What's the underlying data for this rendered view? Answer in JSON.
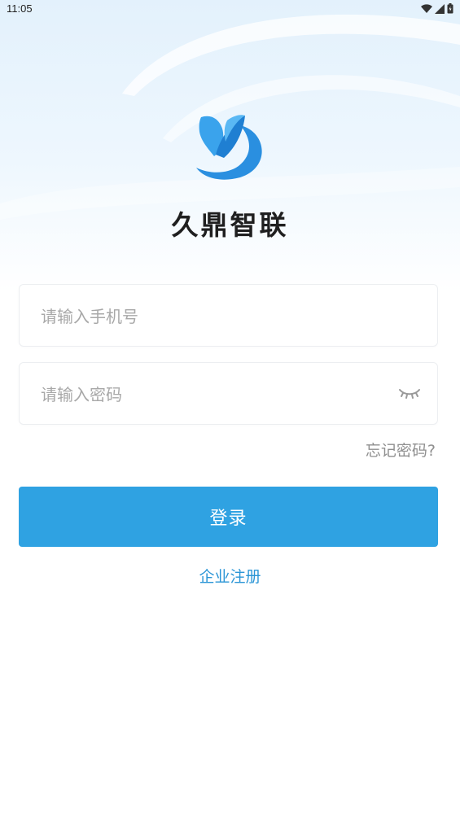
{
  "status_bar": {
    "time": "11:05",
    "icons": [
      "wifi-icon",
      "signal-icon",
      "battery-icon"
    ]
  },
  "brand": {
    "logo_icon": "brand-logo-icon",
    "name": "久鼎智联",
    "accent_color": "#2fa2e2"
  },
  "login_form": {
    "phone_placeholder": "请输入手机号",
    "phone_value": "",
    "password_placeholder": "请输入密码",
    "password_value": "",
    "password_toggle_icon": "eye-closed-icon",
    "forgot_label": "忘记密码?",
    "login_label": "登录",
    "register_label": "企业注册"
  }
}
